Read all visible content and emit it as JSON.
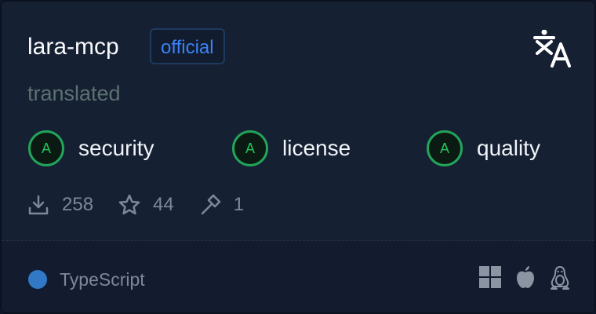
{
  "package": {
    "name": "lara-mcp",
    "badge": "official",
    "subtitle": "translated"
  },
  "scores": [
    {
      "grade": "A",
      "label": "security"
    },
    {
      "grade": "A",
      "label": "license"
    },
    {
      "grade": "A",
      "label": "quality"
    }
  ],
  "stats": {
    "downloads": "258",
    "stars": "44",
    "tools": "1"
  },
  "footer": {
    "language": "TypeScript",
    "language_color": "#3178c6",
    "platforms": [
      "windows-icon",
      "apple-icon",
      "linux-icon"
    ]
  },
  "colors": {
    "accent": "#3b82f6",
    "grade_green": "#22c55e",
    "background": "#162033"
  }
}
